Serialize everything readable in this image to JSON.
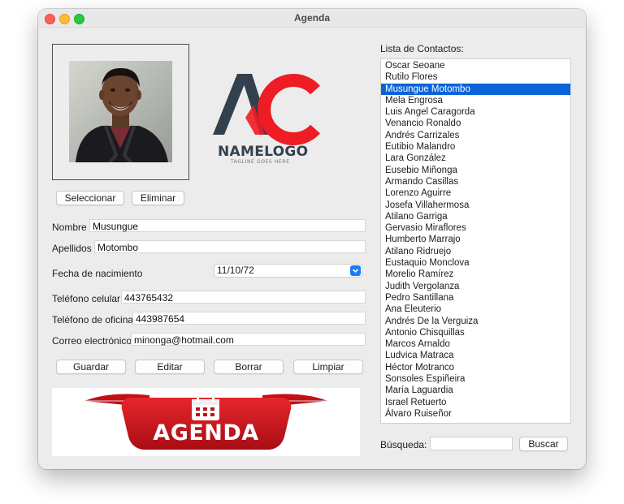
{
  "window": {
    "title": "Agenda"
  },
  "photo_section": {
    "select_label": "Seleccionar",
    "delete_label": "Eliminar"
  },
  "logo": {
    "name": "NAMELOGO",
    "tagline": "TAGLINE GOES HERE",
    "brand_dark": "#33414f",
    "brand_red": "#ee1c25"
  },
  "form": {
    "nombre": {
      "label": "Nombre",
      "value": "Musungue"
    },
    "apellidos": {
      "label": "Apellidos",
      "value": "Motombo"
    },
    "fecha": {
      "label": "Fecha de nacimiento",
      "value": "11/10/72"
    },
    "celular": {
      "label": "Teléfono celular",
      "value": "443765432"
    },
    "oficina": {
      "label": "Teléfono de oficina",
      "value": "443987654"
    },
    "correo": {
      "label": "Correo electrónico",
      "value": "minonga@hotmail.com"
    }
  },
  "actions": {
    "guardar": "Guardar",
    "editar": "Editar",
    "borrar": "Borrar",
    "limpiar": "Limpiar"
  },
  "banner": {
    "text": "AGENDA",
    "color": "#d4141c"
  },
  "contacts": {
    "label": "Lista de Contactos:",
    "selected_index": 2,
    "selected_color": "#0a63d8",
    "items": [
      "Oscar Seoane",
      "Rutilo Flores",
      "Musungue Motombo",
      "Mela Engrosa",
      "Luis Angel Caragorda",
      "Venancio Ronaldo",
      "Andrés Carrizales",
      "Eutibio Malandro",
      "Lara González",
      "Eusebio Miñonga",
      "Armando Casillas",
      "Lorenzo Aguirre",
      "Josefa Villahermosa",
      "Atilano Garriga",
      "Gervasio Miraflores",
      "Humberto Marrajo",
      "Atilano Ridruejo",
      "Eustaquio Monclova",
      "Morelio Ramírez",
      "Judith Vergolanza",
      "Pedro Santillana",
      "Ana Eleuterio",
      "Andrés De la Verguiza",
      "Antonio Chisquillas",
      "Marcos Arnaldo",
      "Ludvica Matraca",
      "Héctor Motranco",
      "Sonsoles Espiñeira",
      "María Laguardia",
      "Israel Retuerto",
      "Álvaro Ruiseñor"
    ]
  },
  "search": {
    "label": "Búsqueda:",
    "value": "",
    "button_label": "Buscar"
  }
}
